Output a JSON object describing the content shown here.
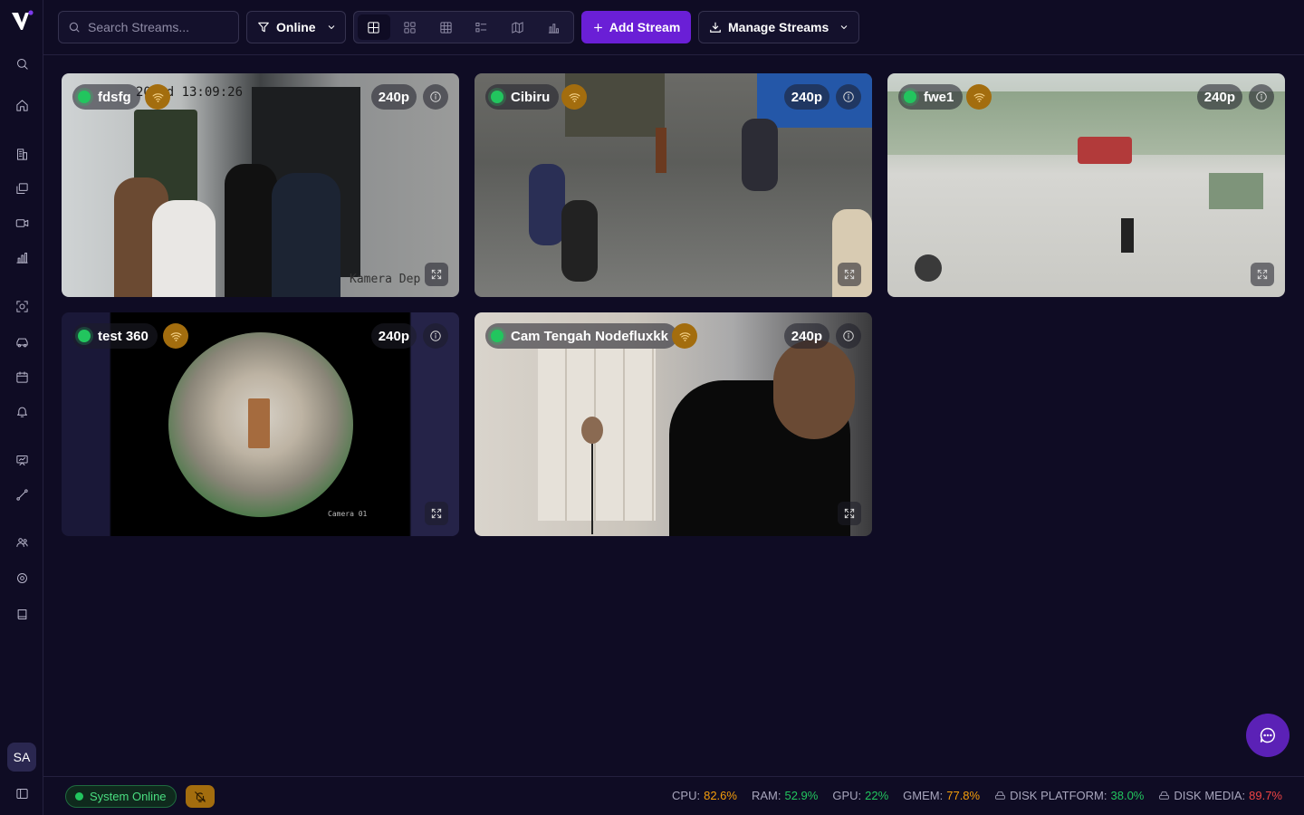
{
  "search": {
    "placeholder": "Search Streams..."
  },
  "toolbar": {
    "filter_label": "Online",
    "add_label": "Add Stream",
    "manage_label": "Manage Streams"
  },
  "avatar": {
    "initials": "SA"
  },
  "streams": [
    {
      "name": "fdsfg",
      "resolution": "240p",
      "status": "online",
      "overlay": "20   ed 13:09:26",
      "watermark": "Kamera Dep"
    },
    {
      "name": "Cibiru",
      "resolution": "240p",
      "status": "online"
    },
    {
      "name": "fwe1",
      "resolution": "240p",
      "status": "online"
    },
    {
      "name": "test 360",
      "resolution": "240p",
      "status": "online",
      "watermark": "Camera 01"
    },
    {
      "name": "Cam Tengah Nodefluxkk",
      "resolution": "240p",
      "status": "online"
    }
  ],
  "footer": {
    "system_status": "System Online",
    "stats": [
      {
        "label": "CPU:",
        "value": "82.6%",
        "level": "orange"
      },
      {
        "label": "RAM:",
        "value": "52.9%",
        "level": "green"
      },
      {
        "label": "GPU:",
        "value": "22%",
        "level": "green"
      },
      {
        "label": "GMEM:",
        "value": "77.8%",
        "level": "orange"
      },
      {
        "label": "DISK PLATFORM:",
        "value": "38.0%",
        "level": "green"
      },
      {
        "label": "DISK MEDIA:",
        "value": "89.7%",
        "level": "red"
      }
    ]
  },
  "colors": {
    "accent": "#6a1fd6",
    "online": "#22c55e",
    "warning": "#a36d0e",
    "background": "#0f0c24"
  }
}
